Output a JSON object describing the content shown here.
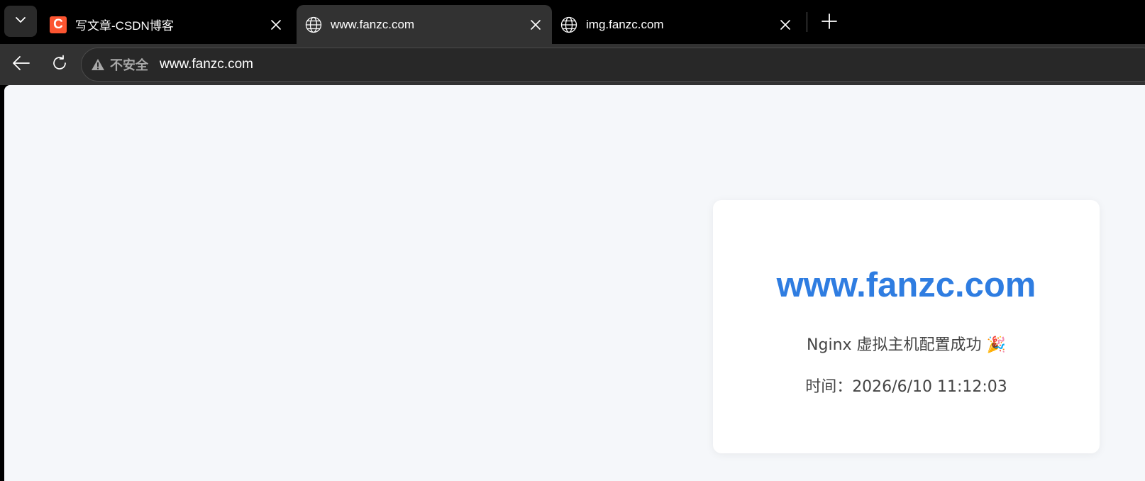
{
  "tabs": [
    {
      "title": "写文章-CSDN博客",
      "favicon": "csdn-icon",
      "favicon_letter": "C",
      "active": false
    },
    {
      "title": "www.fanzc.com",
      "favicon": "globe-icon",
      "active": true
    },
    {
      "title": "img.fanzc.com",
      "favicon": "globe-icon",
      "active": false
    }
  ],
  "toolbar": {
    "security_label": "不安全",
    "url": "www.fanzc.com"
  },
  "page": {
    "heading": "www.fanzc.com",
    "message": "Nginx 虚拟主机配置成功 🎉",
    "time_text": "时间：2026/6/10 11:12:03"
  },
  "colors": {
    "accent": "#2f7de1",
    "csdn_brand": "#fc5531",
    "page_bg": "#f5f7fa"
  }
}
